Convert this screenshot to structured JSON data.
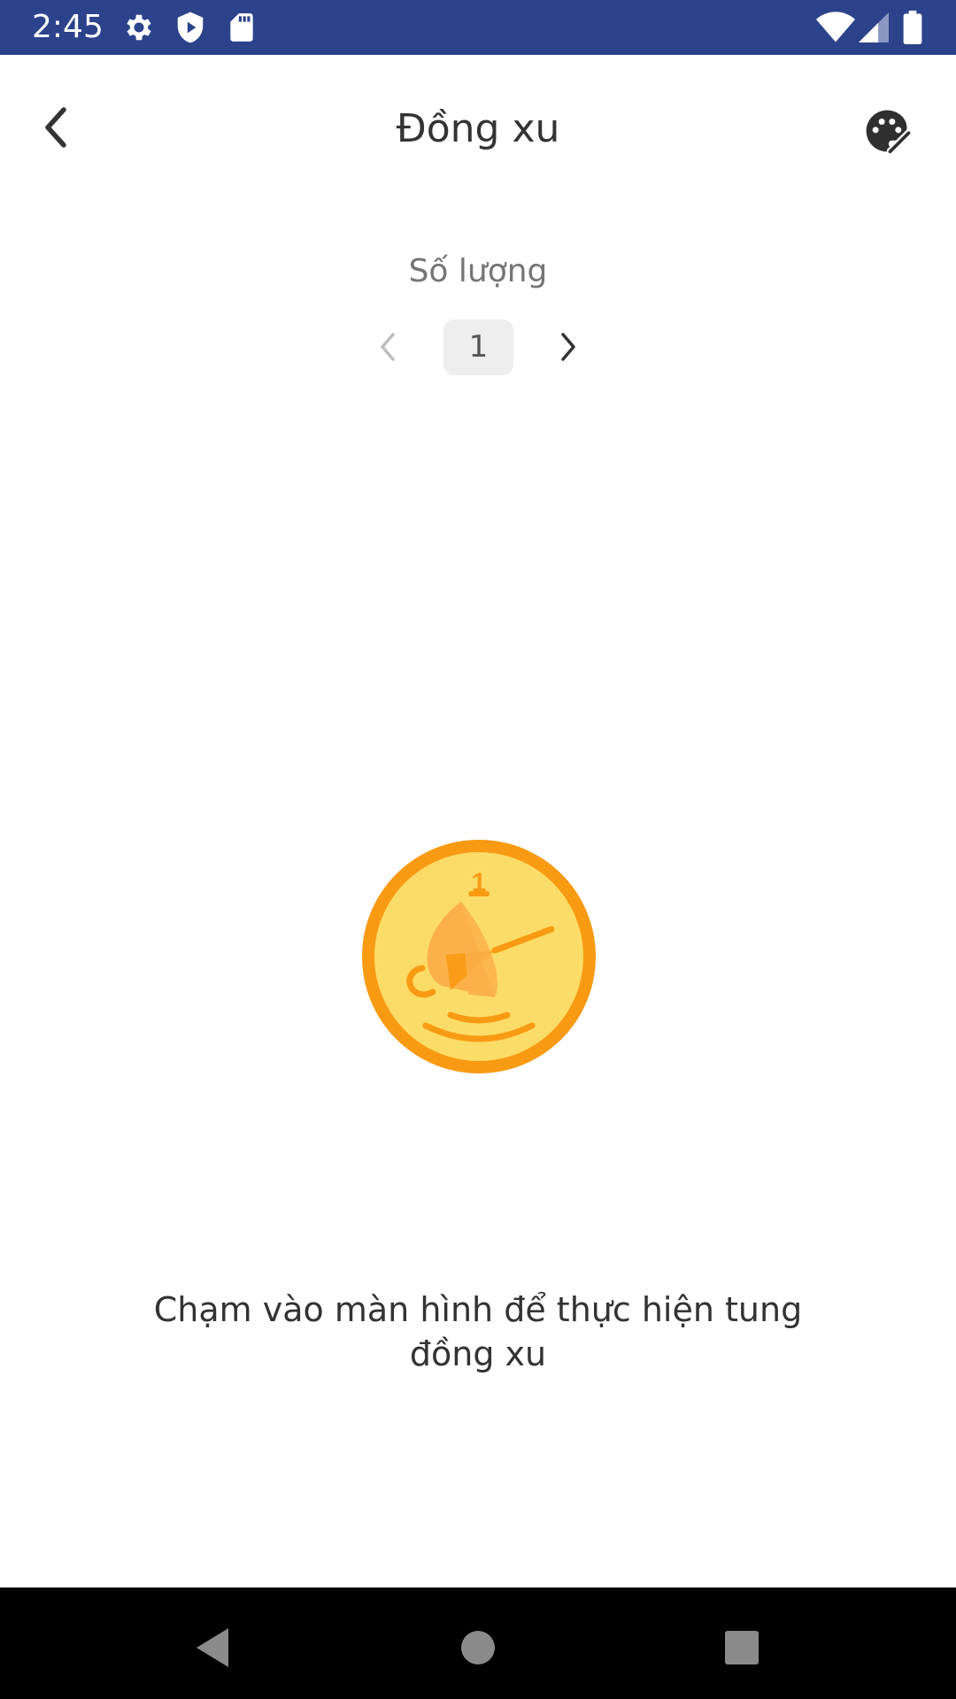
{
  "status_bar": {
    "time": "2:45",
    "icons": [
      "gear-icon",
      "shield-play-icon",
      "sd-card-icon",
      "wifi-icon",
      "signal-icon",
      "battery-icon"
    ],
    "background": "#2c428b"
  },
  "header": {
    "title": "Đồng xu",
    "back_icon": "chevron-left-icon",
    "palette_icon": "palette-icon"
  },
  "quantity": {
    "label": "Số lượng",
    "value": "1"
  },
  "coin": {
    "number": "1",
    "outer_color": "#f99a13",
    "inner_color": "#fcdc68"
  },
  "instruction": "Chạm vào màn hình để thực hiện tung đồng xu",
  "nav_bar": {
    "buttons": [
      "back-triangle-icon",
      "home-circle-icon",
      "recents-square-icon"
    ]
  }
}
